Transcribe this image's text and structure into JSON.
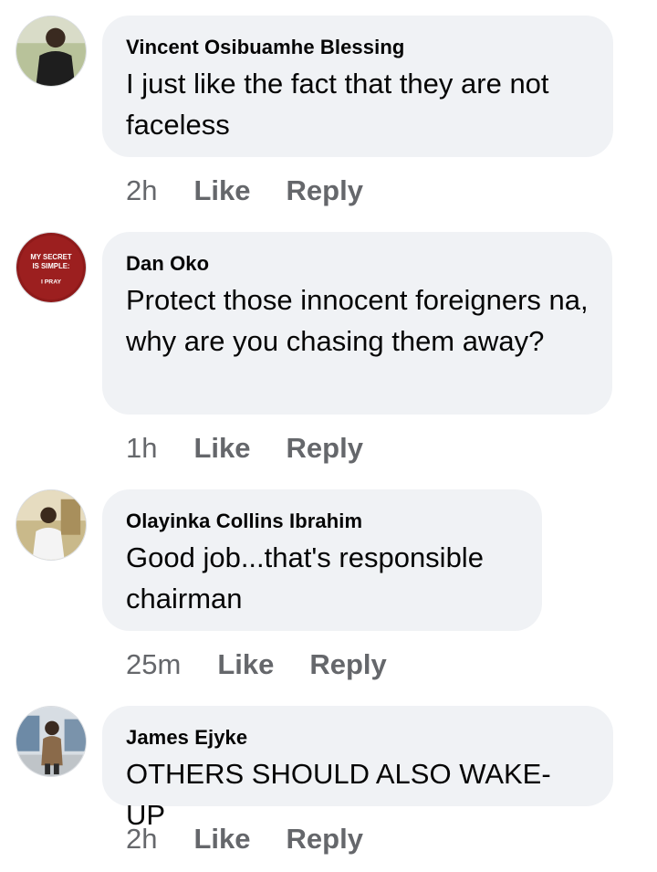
{
  "comments": [
    {
      "author": "Vincent Osibuamhe Blessing",
      "text": "I just like the fact that they are not faceless",
      "time": "2h",
      "like_label": "Like",
      "reply_label": "Reply"
    },
    {
      "author": "Dan Oko",
      "text": "Protect those innocent foreigners na, why are you chasing them away?",
      "time": "1h",
      "like_label": "Like",
      "reply_label": "Reply",
      "avatar_text": [
        "MY SECRET",
        "IS SIMPLE:",
        "I PRAY"
      ]
    },
    {
      "author": "Olayinka Collins Ibrahim",
      "text": "Good job...that's responsible chairman",
      "time": "25m",
      "like_label": "Like",
      "reply_label": "Reply"
    },
    {
      "author": "James Ejyke",
      "text": "OTHERS SHOULD ALSO WAKE-UP",
      "time": "2h",
      "like_label": "Like",
      "reply_label": "Reply"
    }
  ],
  "colors": {
    "bubble": "#f0f2f5",
    "meta_text": "#65676b",
    "author_text": "#050505"
  }
}
